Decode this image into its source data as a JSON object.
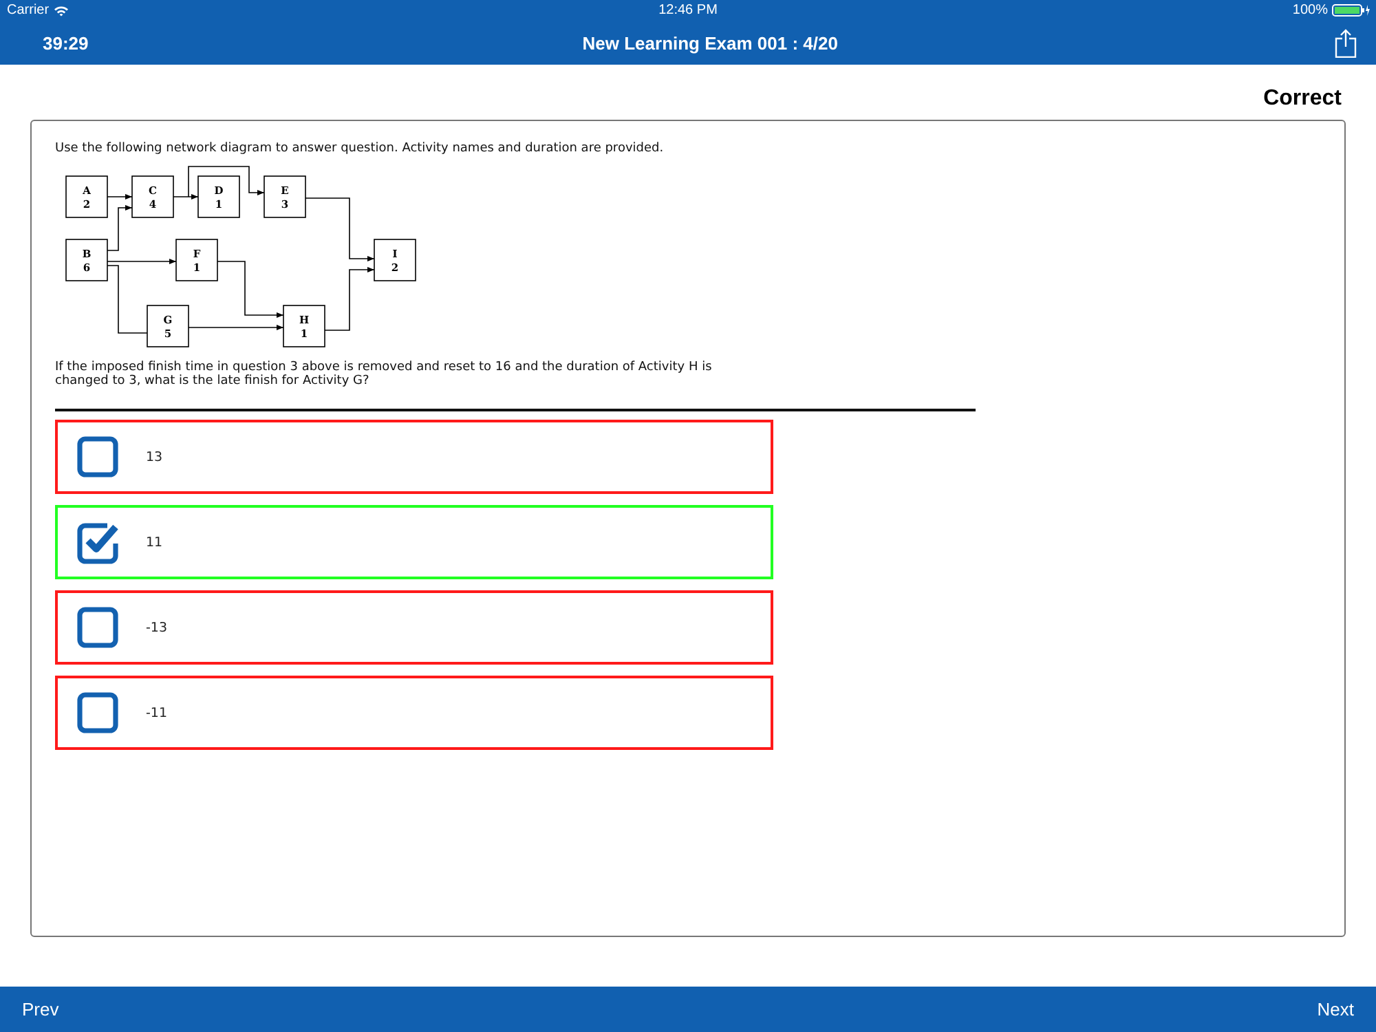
{
  "status_bar": {
    "carrier": "Carrier",
    "time": "12:46 PM",
    "battery": "100%"
  },
  "nav_bar": {
    "timer": "39:29",
    "title": "New Learning Exam 001 : 4/20"
  },
  "result": "Correct",
  "question": {
    "intro": "Use the following network diagram to answer question. Activity names and duration are provided.",
    "diagram_nodes": [
      {
        "name": "A",
        "duration": "2"
      },
      {
        "name": "C",
        "duration": "4"
      },
      {
        "name": "D",
        "duration": "1"
      },
      {
        "name": "E",
        "duration": "3"
      },
      {
        "name": "B",
        "duration": "6"
      },
      {
        "name": "F",
        "duration": "1"
      },
      {
        "name": "I",
        "duration": "2"
      },
      {
        "name": "G",
        "duration": "5"
      },
      {
        "name": "H",
        "duration": "1"
      }
    ],
    "text": "If the imposed finish time in question 3 above is removed and reset to 16 and the duration of Activity H is changed to 3, what is the late finish for Activity G?"
  },
  "options": [
    {
      "text": "13",
      "checked": false,
      "correct": false
    },
    {
      "text": "11",
      "checked": true,
      "correct": true
    },
    {
      "text": "-13",
      "checked": false,
      "correct": false
    },
    {
      "text": "-11",
      "checked": false,
      "correct": false
    }
  ],
  "bottom_bar": {
    "prev": "Prev",
    "next": "Next"
  }
}
